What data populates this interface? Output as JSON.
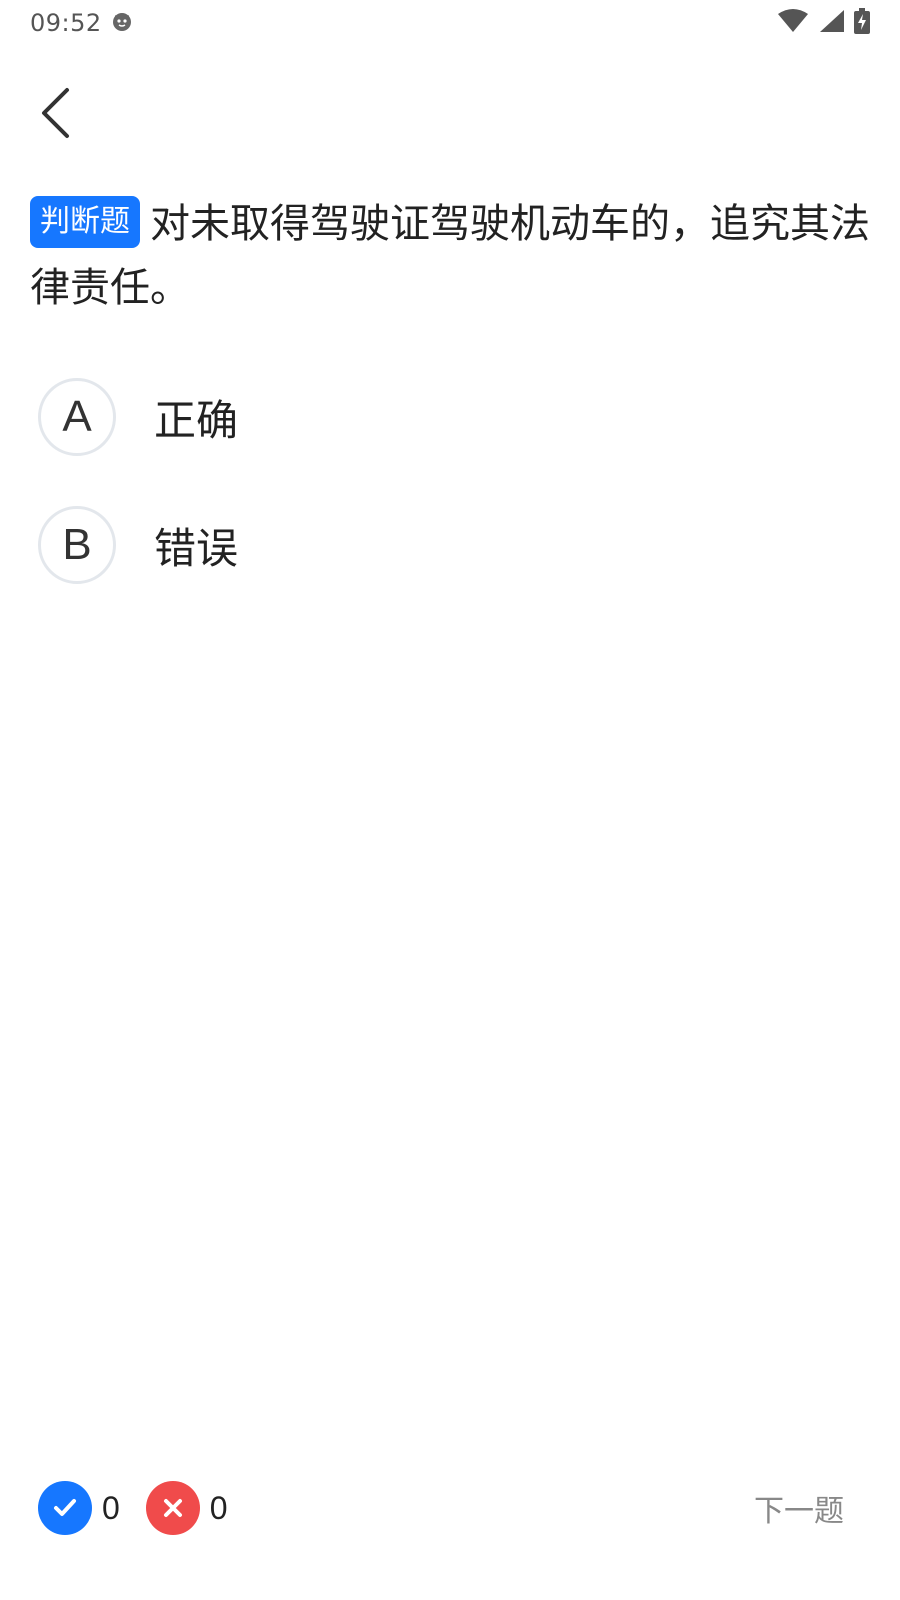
{
  "status_bar": {
    "time": "09:52",
    "icons": [
      "notification-cat-icon",
      "wifi-icon",
      "signal-icon",
      "battery-charging-icon"
    ]
  },
  "nav": {
    "back_icon": "chevron-left-icon"
  },
  "question": {
    "type_badge": "判断题",
    "text": "对未取得驾驶证驾驶机动车的，追究其法律责任。"
  },
  "options": [
    {
      "letter": "A",
      "text": "正确"
    },
    {
      "letter": "B",
      "text": "错误"
    }
  ],
  "footer": {
    "correct_count": "0",
    "wrong_count": "0",
    "next_label": "下一题"
  },
  "colors": {
    "accent": "#1677ff",
    "correct": "#1677ff",
    "wrong": "#f04b4b",
    "option_border": "#e3e7ec"
  }
}
